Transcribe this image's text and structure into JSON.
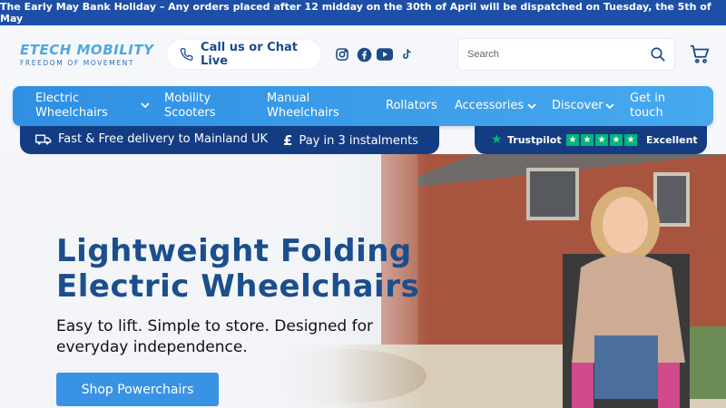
{
  "announcement": "The Early May Bank Holiday – Any orders placed after 12 midday on the 30th of April will be dispatched on Tuesday, the 5th of May",
  "logo": {
    "name": "ETECH MOBILITY",
    "tagline": "FREEDOM OF MOVEMENT"
  },
  "header": {
    "call_label": "Call us or Chat Live",
    "social": [
      "instagram-icon",
      "facebook-icon",
      "youtube-icon",
      "tiktok-icon"
    ],
    "search_placeholder": "Search"
  },
  "nav": {
    "items": [
      {
        "label_line1": "Electric",
        "label_line2": "Wheelchairs",
        "dropdown": true
      },
      {
        "label_line1": "Mobility",
        "label_line2": "Scooters",
        "dropdown": false
      },
      {
        "label_line1": "Manual",
        "label_line2": "Wheelchairs",
        "dropdown": false
      },
      {
        "label": "Rollators",
        "dropdown": false
      },
      {
        "label": "Accessories",
        "dropdown": true
      },
      {
        "label": "Discover",
        "dropdown": true
      },
      {
        "label_line1": "Get in",
        "label_line2": "touch",
        "dropdown": false
      }
    ]
  },
  "benefits": {
    "delivery": "Fast & Free delivery to Mainland UK",
    "instalments": "Pay in 3 instalments"
  },
  "trustpilot": {
    "brand": "Trustpilot",
    "rating_text": "Excellent",
    "stars": 5,
    "star_color": "#00b67a"
  },
  "hero": {
    "title_line1": "Lightweight Folding",
    "title_line2": "Electric Wheelchairs",
    "subtitle_line1": "Easy to lift. Simple to store. Designed for",
    "subtitle_line2": "everyday independence.",
    "cta": "Shop Powerchairs"
  },
  "colors": {
    "brand_dark": "#143c82",
    "brand_blue": "#2f8fe3",
    "title": "#1b4e8c",
    "cta": "#3a92e4"
  }
}
